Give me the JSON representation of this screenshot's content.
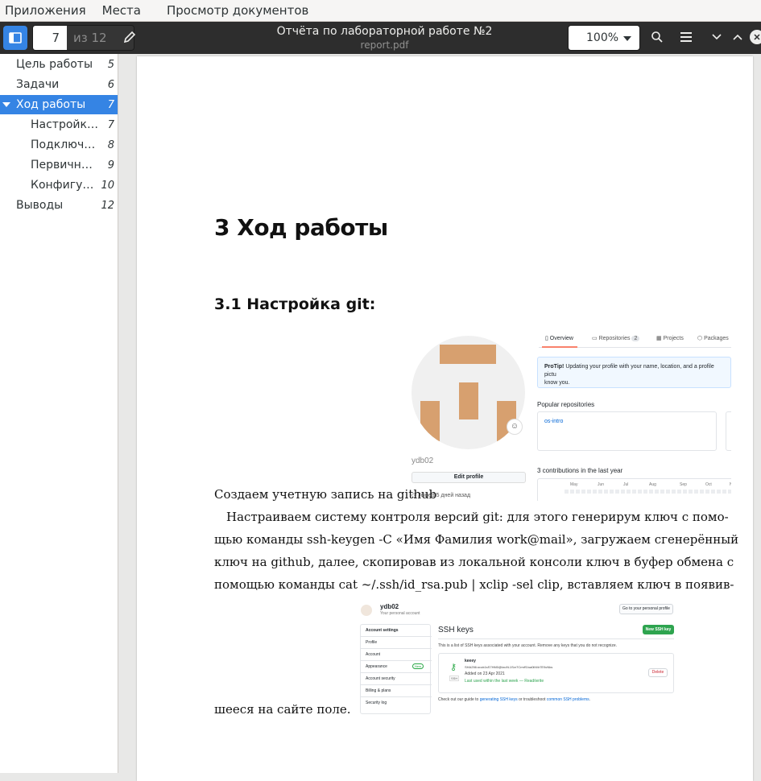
{
  "menubar": {
    "items": [
      "Приложения",
      "Места",
      "Просмотр документов"
    ]
  },
  "header": {
    "page_current": "7",
    "page_total": "из 12",
    "title": "Отчёта по лабораторной работе №2",
    "filename": "report.pdf",
    "zoom": "100%"
  },
  "toc": [
    {
      "label": "Цель работы",
      "page": "5",
      "level": 0,
      "selected": false
    },
    {
      "label": "Задачи",
      "page": "6",
      "level": 0,
      "selected": false
    },
    {
      "label": "Ход работы",
      "page": "7",
      "level": 0,
      "selected": true,
      "expanded": true
    },
    {
      "label": "Настройка …",
      "page": "7",
      "level": 1,
      "selected": false
    },
    {
      "label": "Подключе…",
      "page": "8",
      "level": 1,
      "selected": false
    },
    {
      "label": "Первична…",
      "page": "9",
      "level": 1,
      "selected": false
    },
    {
      "label": "Конфигура…",
      "page": "10",
      "level": 1,
      "selected": false
    },
    {
      "label": "Выводы",
      "page": "12",
      "level": 0,
      "selected": false
    }
  ],
  "document": {
    "h1": "3  Ход работы",
    "h2": "3.1  Настройка git:",
    "caption1": "Создаем учетную запись на github",
    "para_lines": [
      "Настраиваем систему контроля версий git: для этого генерирум ключ с помо-",
      "щью команды ssh-keygen -C «Имя Фамилия work@mail», загружаем сгенерённый",
      "ключ на github, далее, скопировав из локальной консоли ключ в буфер обмена с",
      "помощью команды cat ~/.ssh/id_rsa.pub | xclip -sel clip, вставляем ключ в появив-"
    ],
    "para_end": "шееся  на  сайте  поле."
  },
  "github_profile": {
    "username": "ydb02",
    "edit_profile": "Edit profile",
    "joined": "Joined 5 дней назад",
    "tabs": {
      "overview": "Overview",
      "repositories": "Repositories",
      "repo_count": "2",
      "projects": "Projects",
      "packages": "Packages"
    },
    "protip_bold": "ProTip!",
    "protip_text": " Updating your profile with your name, location, and a profile pictu",
    "protip_text2": "know you.",
    "popular": "Popular repositories",
    "repo": "os-intro",
    "contributions": "3 contributions in the last year",
    "months": [
      "May",
      "Jun",
      "Jul",
      "Aug",
      "Sep",
      "Oct",
      "No"
    ]
  },
  "github_ssh": {
    "username": "ydb02",
    "personal": "Your personal account",
    "goto": "Go to your personal profile",
    "menu": [
      "Account settings",
      "Profile",
      "Account",
      "Appearance",
      "Account security",
      "Billing & plans",
      "Security log"
    ],
    "new_badge": "New",
    "title": "SSH keys",
    "new_key": "New SSH key",
    "desc": "This is a list of SSH keys associated with your account. Remove any keys that you do not recognize.",
    "key_name": "keeey",
    "fingerprint": "SHA256:ouvk1sS7HM0@tzu9L1Sxr7CrmfS/ua0iM4r7E9cNks",
    "added": "Added on 23 Apr 2021",
    "last_used": "Last used within the last week — Read/write",
    "ssh_label": "SSH",
    "delete": "Delete",
    "guide_pre": "Check out our guide to ",
    "guide_link1": "generating SSH keys",
    "guide_mid": " or troubleshoot ",
    "guide_link2": "common SSH problems",
    "guide_post": "."
  },
  "colors": {
    "accent": "#3584e4",
    "header_bg": "#2d2d2d",
    "avatar_block": "#d7a06f"
  }
}
